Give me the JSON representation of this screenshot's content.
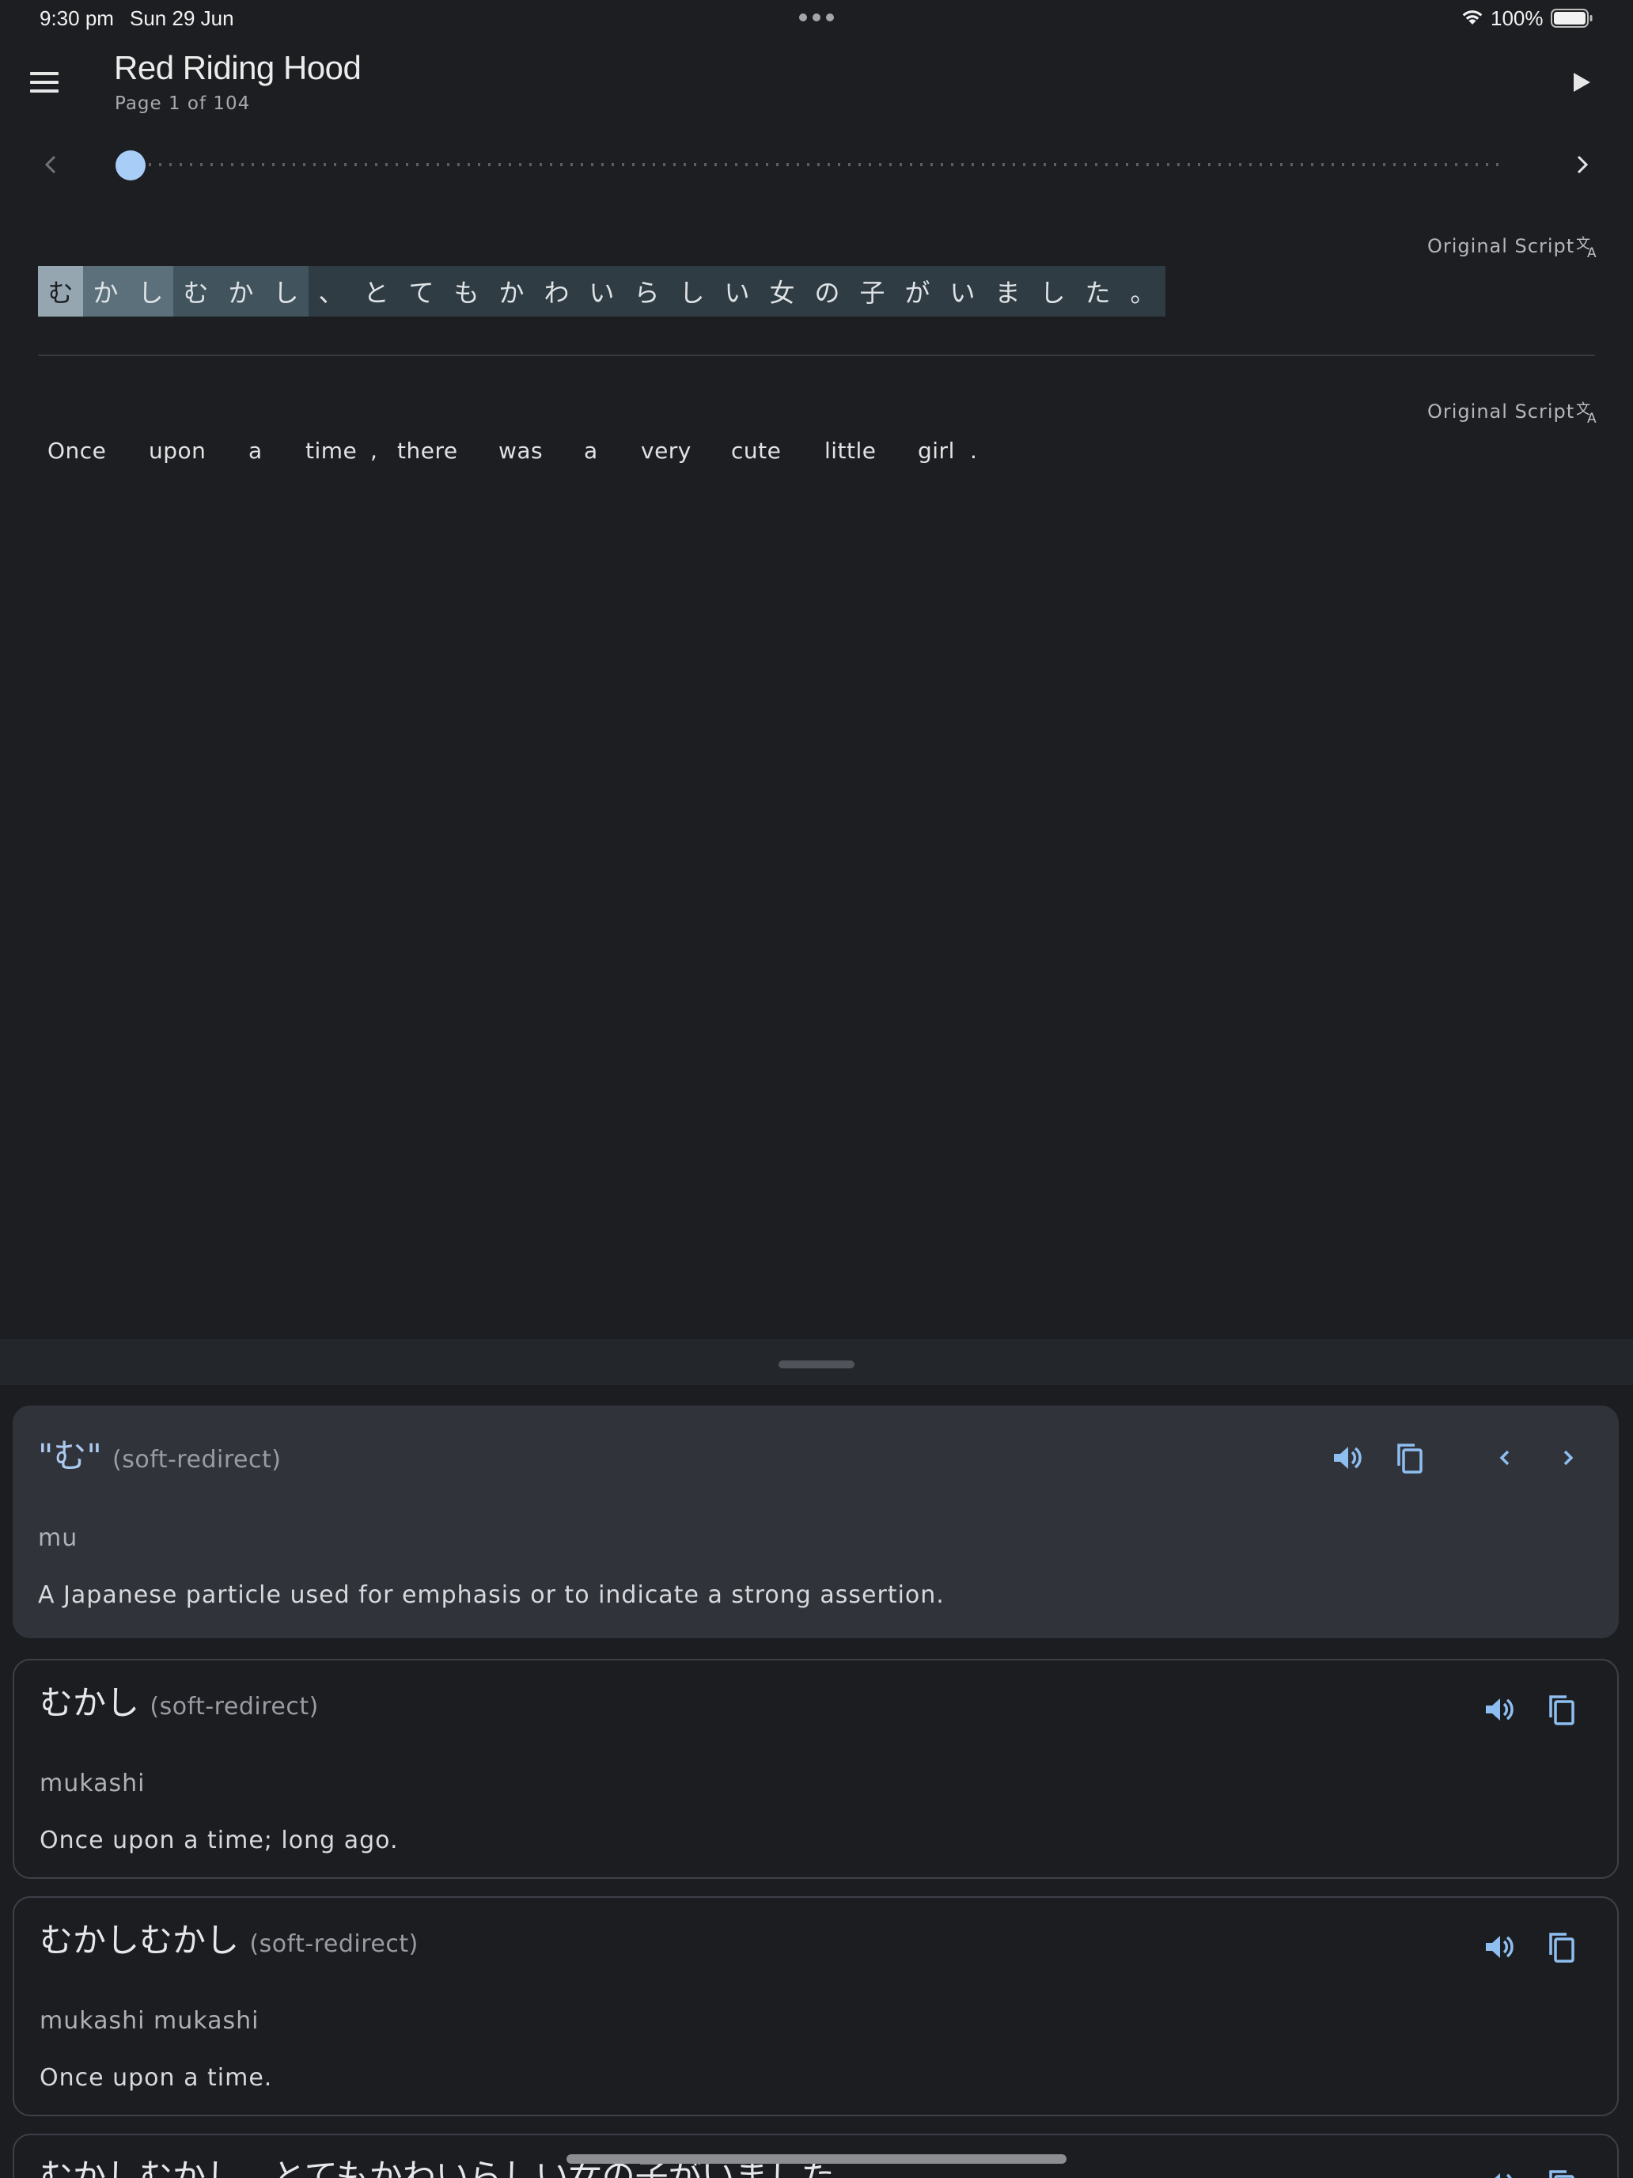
{
  "status_bar": {
    "time": "9:30 pm",
    "date": "Sun 29 Jun",
    "battery": "100%"
  },
  "header": {
    "title": "Red Riding Hood",
    "page_indicator": "Page 1 of 104"
  },
  "slider": {
    "current_page": 1,
    "total_pages": 104
  },
  "original_sentence": {
    "label": "Original Script",
    "chars": [
      "む",
      "か",
      "し",
      "む",
      "か",
      "し",
      "、",
      "と",
      "て",
      "も",
      "か",
      "わ",
      "い",
      "ら",
      "し",
      "い",
      "女",
      "の",
      "子",
      "が",
      "い",
      "ま",
      "し",
      "た",
      "。"
    ]
  },
  "translation_sentence": {
    "label": "Original Script",
    "words": [
      "Once",
      "upon",
      "a",
      "time",
      ",",
      "there",
      "was",
      "a",
      "very",
      "cute",
      "little",
      "girl",
      "."
    ]
  },
  "dictionary": {
    "entries": [
      {
        "headword": "\"む\"",
        "tag": "(soft-redirect)",
        "reading": "mu",
        "gloss": "A Japanese particle used for emphasis or to indicate a strong assertion."
      },
      {
        "headword": "むかし",
        "tag": "(soft-redirect)",
        "reading": "mukashi",
        "gloss": "Once upon a time; long ago."
      },
      {
        "headword": "むかしむかし",
        "tag": "(soft-redirect)",
        "reading": "mukashi mukashi",
        "gloss": "Once upon a time."
      },
      {
        "headword": "むかしむかし、とてもかわいらしい女の子がいました"
      }
    ]
  },
  "colors": {
    "background": "#1d1e21",
    "accent": "#a8cdf7",
    "icon_blue": "#8fbef0",
    "selected_card": "#30333a",
    "sentence_bg": "#2f3c44"
  },
  "icons": {
    "menu": "menu-icon",
    "play": "play-icon",
    "prev": "chevron-left-icon",
    "next": "chevron-right-icon",
    "translate": "translate-icon",
    "speaker": "volume-icon",
    "copy": "copy-icon"
  }
}
